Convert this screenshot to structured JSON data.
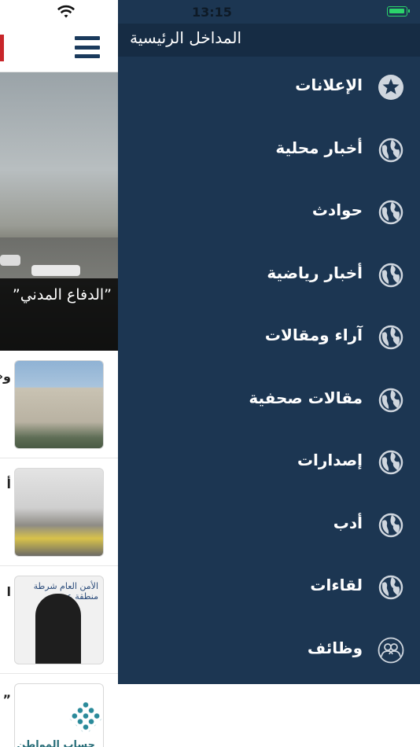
{
  "status_bar": {
    "time": "13:15"
  },
  "drawer": {
    "title": "المداخل الرئيسية",
    "background_color": "#1c3652",
    "header_color": "#162c44",
    "items": [
      {
        "label": "الإعلانات",
        "icon": "star-icon"
      },
      {
        "label": "أخبار محلية",
        "icon": "globe-icon"
      },
      {
        "label": "حوادث",
        "icon": "globe-icon"
      },
      {
        "label": "أخبار رياضية",
        "icon": "globe-icon"
      },
      {
        "label": "آراء ومقالات",
        "icon": "globe-icon"
      },
      {
        "label": "مقالات صحفية",
        "icon": "globe-icon"
      },
      {
        "label": "إصدارات",
        "icon": "globe-icon"
      },
      {
        "label": "أدب",
        "icon": "globe-icon"
      },
      {
        "label": "لقاءات",
        "icon": "globe-icon"
      },
      {
        "label": "وظائف",
        "icon": "users-icon"
      }
    ]
  },
  "background_page": {
    "hero_caption": "”الدفاع المدني”",
    "news": [
      {
        "text": "و«"
      },
      {
        "text": "أ"
      },
      {
        "text": "ا"
      },
      {
        "text": "”"
      }
    ],
    "thumb3_caption": "الأمن العام شرطة منطقة عسير",
    "thumb4_caption": "حساب المواطن"
  }
}
